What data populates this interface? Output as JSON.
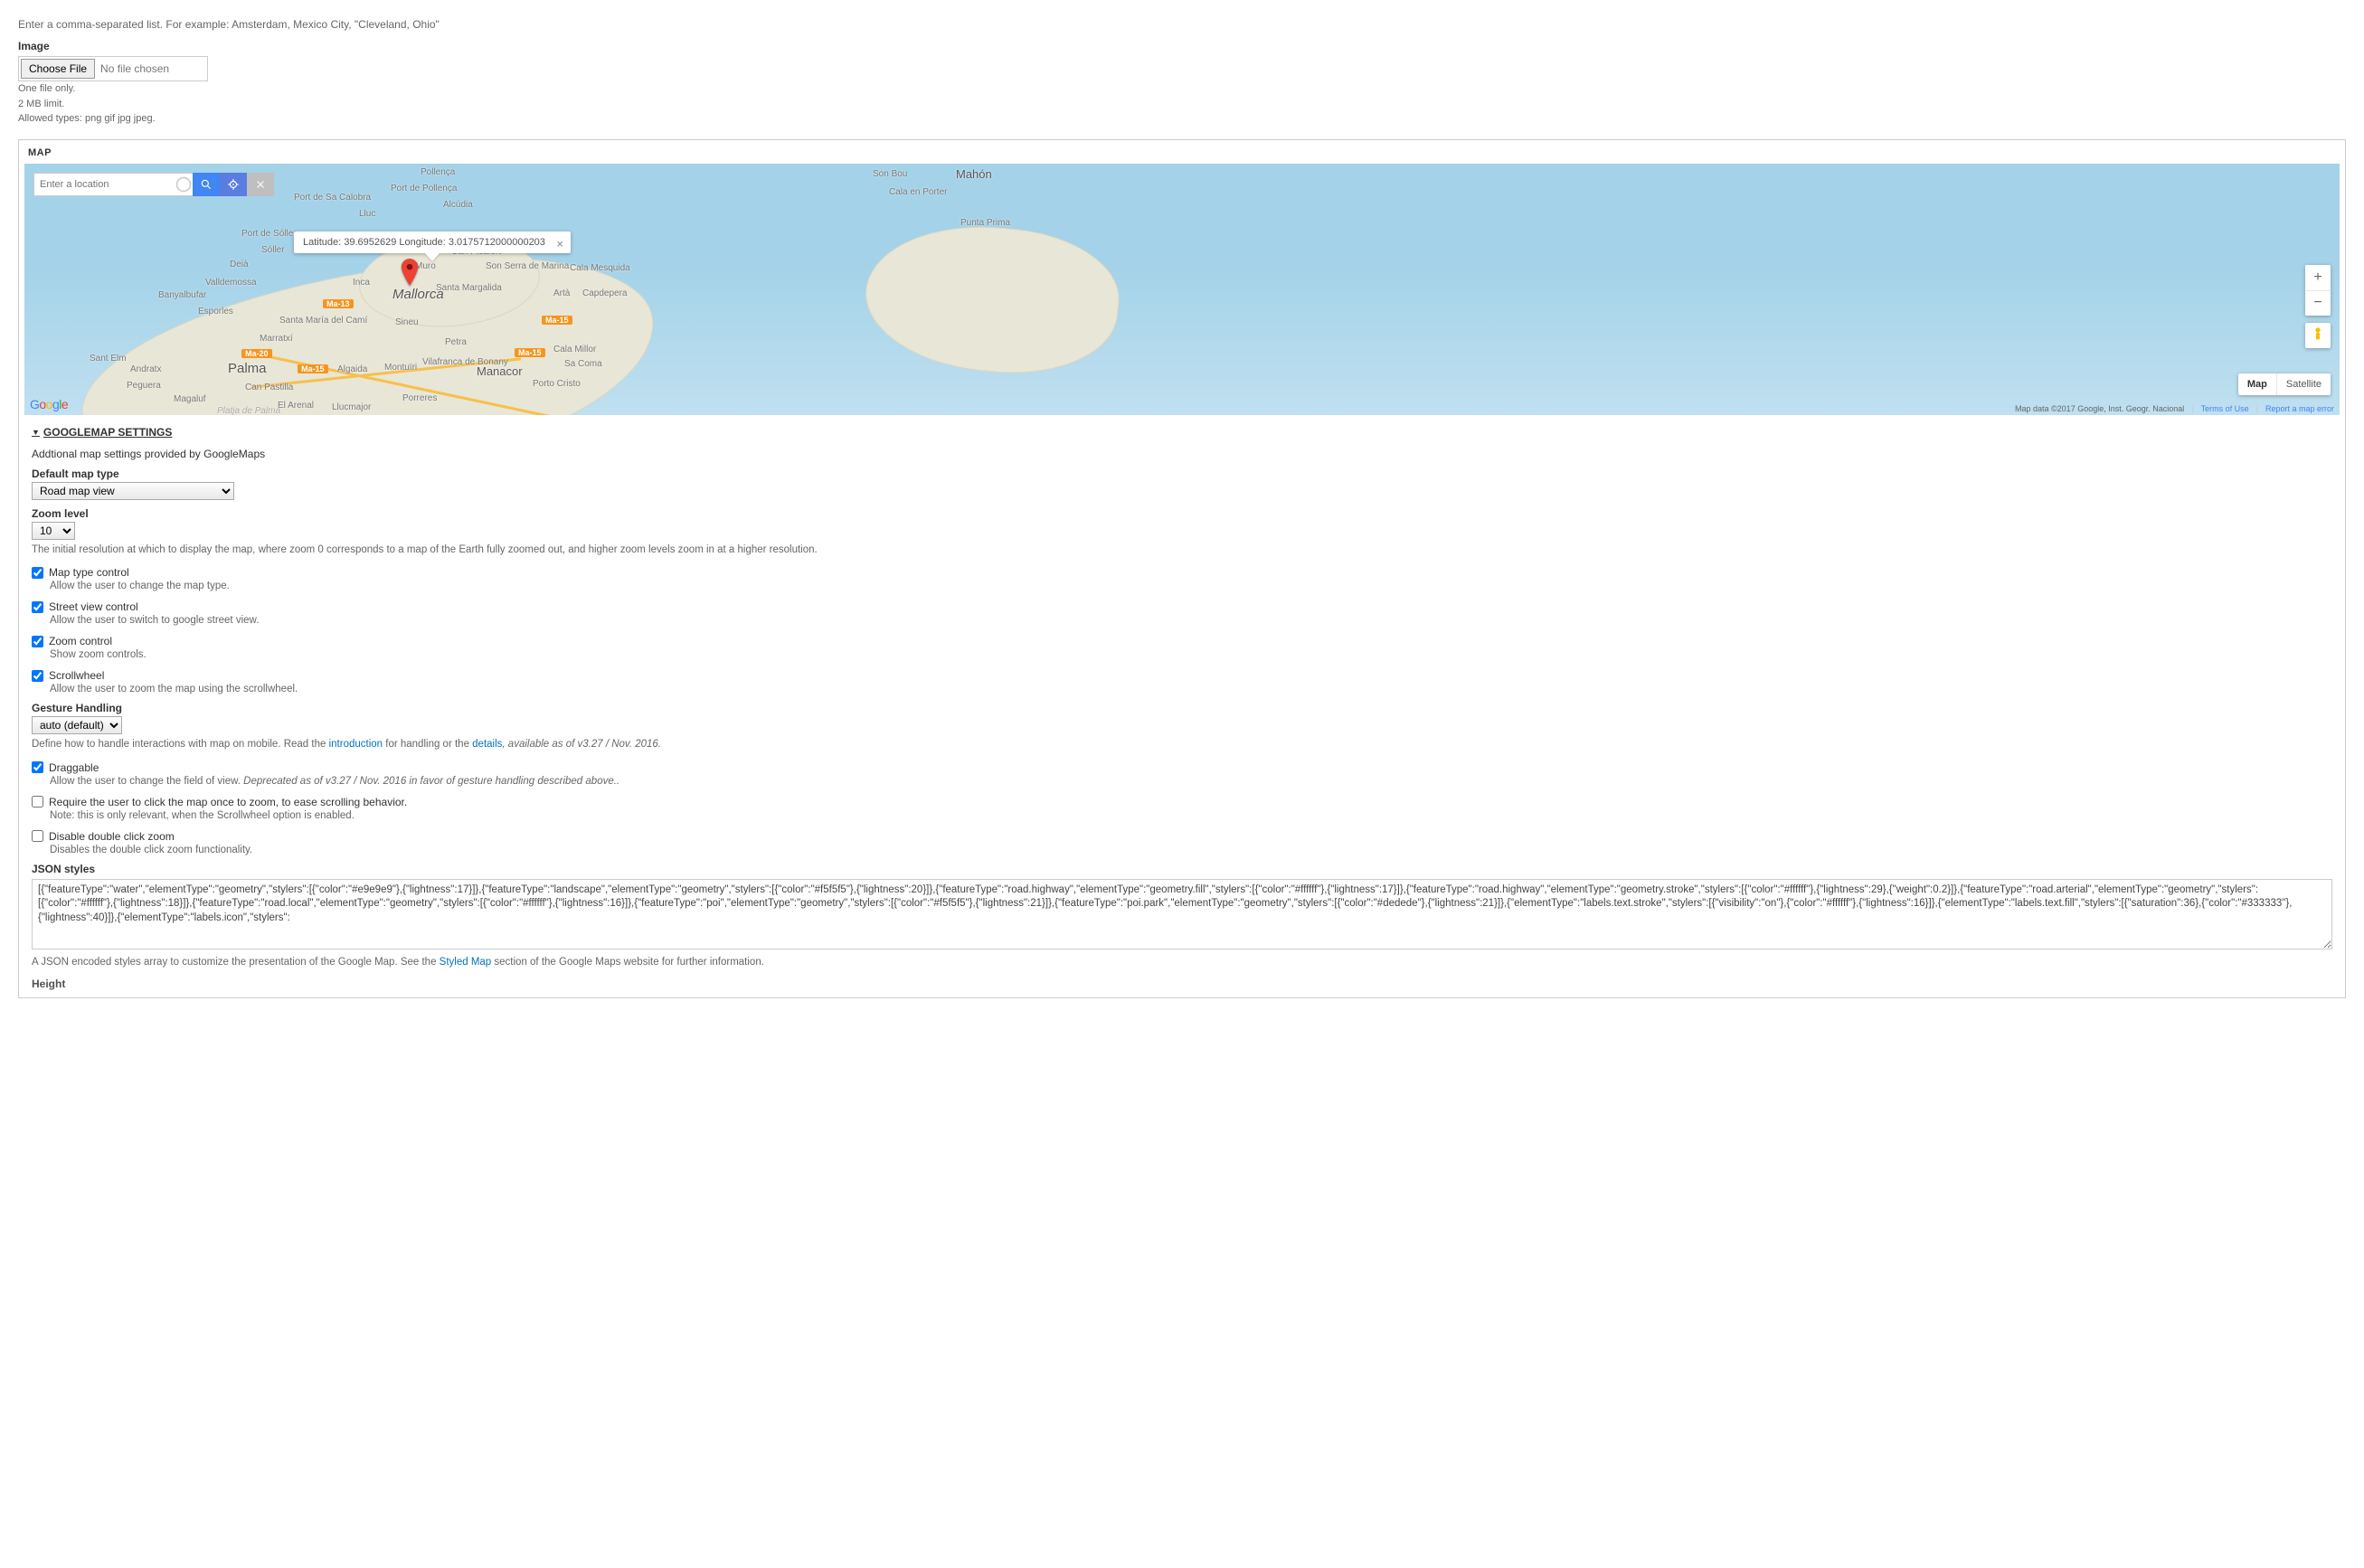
{
  "top_hint": "Enter a comma-separated list. For example: Amsterdam, Mexico City, \"Cleveland, Ohio\"",
  "image_field": {
    "label": "Image",
    "choose_button": "Choose File",
    "status": "No file chosen",
    "notes": [
      "One file only.",
      "2 MB limit.",
      "Allowed types: png gif jpg jpeg."
    ]
  },
  "map_panel": {
    "title": "MAP",
    "search_placeholder": "Enter a location",
    "infowindow": "Latitude: 39.6952629 Longitude: 3.0175712000000203",
    "map_type_options": [
      "Map",
      "Satellite"
    ],
    "footer": {
      "copyright": "Map data ©2017 Google, Inst. Geogr. Nacional",
      "terms": "Terms of Use",
      "report": "Report a map error"
    },
    "places": {
      "pollenca": "Pollença",
      "alcudia": "Alcúdia",
      "port_pollenca": "Port de Pollença",
      "port_sa_calobra": "Port de Sa Calobra",
      "lluc": "Lluc",
      "port_soller": "Port de Sóller",
      "soller": "Sóller",
      "deia": "Deià",
      "valldemossa": "Valldemossa",
      "banyalbufar": "Banyalbufar",
      "esporles": "Esporles",
      "inca": "Inca",
      "muro": "Muro",
      "can_picafort": "Can Picafort",
      "son_serra": "Son Serra de Marina",
      "santa_margalida": "Santa Margalida",
      "cala_mesquida": "Cala Mesquida",
      "arta": "Artà",
      "capdepera": "Capdepera",
      "mallorca": "Mallorca",
      "santa_maria": "Santa María del Camí",
      "marratxi": "Marratxí",
      "sineu": "Sineu",
      "petra": "Petra",
      "cala_millor": "Cala Millor",
      "sant_elm": "Sant Elm",
      "andratx": "Andratx",
      "peguera": "Peguera",
      "magaluf": "Magaluf",
      "palma": "Palma",
      "can_pastilla": "Can Pastilla",
      "el_arenal": "El Arenal",
      "platja_palma": "Platja de Palma",
      "algaida": "Algaida",
      "llucmajor": "Llucmajor",
      "montuiri": "Montuïri",
      "porreres": "Porreres",
      "vilafranca": "Vilafranca de Bonany",
      "manacor": "Manacor",
      "sa_coma": "Sa Coma",
      "porto_cristo": "Porto Cristo",
      "son_bou": "Son Bou",
      "cala_porter": "Cala en Porter",
      "mahon": "Mahón",
      "punta_prima": "Punta Prima"
    },
    "road_badges": {
      "ma13": "Ma-13",
      "ma20": "Ma-20",
      "ma15a": "Ma-15",
      "ma15b": "Ma-15",
      "ma15c": "Ma-15"
    }
  },
  "settings": {
    "summary": "GOOGLEMAP SETTINGS",
    "description": "Addtional map settings provided by GoogleMaps",
    "default_map_type": {
      "label": "Default map type",
      "value": "Road map view"
    },
    "zoom_level": {
      "label": "Zoom level",
      "value": "10",
      "help": "The initial resolution at which to display the map, where zoom 0 corresponds to a map of the Earth fully zoomed out, and higher zoom levels zoom in at a higher resolution."
    },
    "map_type_control": {
      "label": "Map type control",
      "help": "Allow the user to change the map type."
    },
    "street_view_control": {
      "label": "Street view control",
      "help": "Allow the user to switch to google street view."
    },
    "zoom_control": {
      "label": "Zoom control",
      "help": "Show zoom controls."
    },
    "scrollwheel": {
      "label": "Scrollwheel",
      "help": "Allow the user to zoom the map using the scrollwheel."
    },
    "gesture_handling": {
      "label": "Gesture Handling",
      "value": "auto (default)",
      "help_pre": "Define how to handle interactions with map on mobile. Read the ",
      "help_link1": "introduction",
      "help_mid": " for handling or the ",
      "help_link2": "details",
      "help_post": ", available as of v3.27 / Nov. 2016."
    },
    "draggable": {
      "label": "Draggable",
      "help_pre": "Allow the user to change the field of view. ",
      "help_em": "Deprecated as of v3.27 / Nov. 2016 in favor of gesture handling described above.."
    },
    "require_click": {
      "label": "Require the user to click the map once to zoom, to ease scrolling behavior.",
      "help": "Note: this is only relevant, when the Scrollwheel option is enabled."
    },
    "disable_dblclick": {
      "label": "Disable double click zoom",
      "help": "Disables the double click zoom functionality."
    },
    "json_styles": {
      "label": "JSON styles",
      "value": "[{\"featureType\":\"water\",\"elementType\":\"geometry\",\"stylers\":[{\"color\":\"#e9e9e9\"},{\"lightness\":17}]},{\"featureType\":\"landscape\",\"elementType\":\"geometry\",\"stylers\":[{\"color\":\"#f5f5f5\"},{\"lightness\":20}]},{\"featureType\":\"road.highway\",\"elementType\":\"geometry.fill\",\"stylers\":[{\"color\":\"#ffffff\"},{\"lightness\":17}]},{\"featureType\":\"road.highway\",\"elementType\":\"geometry.stroke\",\"stylers\":[{\"color\":\"#ffffff\"},{\"lightness\":29},{\"weight\":0.2}]},{\"featureType\":\"road.arterial\",\"elementType\":\"geometry\",\"stylers\":[{\"color\":\"#ffffff\"},{\"lightness\":18}]},{\"featureType\":\"road.local\",\"elementType\":\"geometry\",\"stylers\":[{\"color\":\"#ffffff\"},{\"lightness\":16}]},{\"featureType\":\"poi\",\"elementType\":\"geometry\",\"stylers\":[{\"color\":\"#f5f5f5\"},{\"lightness\":21}]},{\"featureType\":\"poi.park\",\"elementType\":\"geometry\",\"stylers\":[{\"color\":\"#dedede\"},{\"lightness\":21}]},{\"elementType\":\"labels.text.stroke\",\"stylers\":[{\"visibility\":\"on\"},{\"color\":\"#ffffff\"},{\"lightness\":16}]},{\"elementType\":\"labels.text.fill\",\"stylers\":[{\"saturation\":36},{\"color\":\"#333333\"},{\"lightness\":40}]},{\"elementType\":\"labels.icon\",\"stylers\":",
      "help_pre": "A JSON encoded styles array to customize the presentation of the Google Map. See the ",
      "help_link": "Styled Map",
      "help_post": " section of the Google Maps website for further information."
    },
    "height_label": "Height"
  }
}
